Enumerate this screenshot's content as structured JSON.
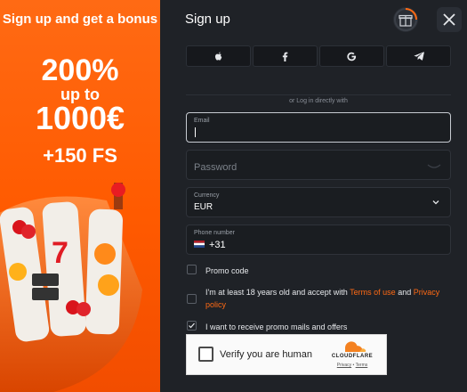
{
  "promo": {
    "headline": "Sign up and get a bonus",
    "percent": "200%",
    "up_to": "up to",
    "amount": "1000€",
    "free_spins": "+150 FS"
  },
  "form": {
    "title": "Sign up",
    "social_buttons": [
      "apple-icon",
      "facebook-icon",
      "google-icon",
      "telegram-icon"
    ],
    "divider_text": "or Log in directly with",
    "email": {
      "label": "Email",
      "value": ""
    },
    "password": {
      "placeholder": "Password"
    },
    "currency": {
      "label": "Currency",
      "value": "EUR"
    },
    "phone": {
      "label": "Phone number",
      "value": "+31"
    },
    "promo_code": {
      "label": "Promo code",
      "checked": false
    },
    "age": {
      "text": "I'm at least 18 years old and accept with",
      "terms_link": "Terms of use",
      "and": "and",
      "privacy_link": "Privacy policy",
      "checked": false
    },
    "promo_mails": {
      "label": "I want to receive promo mails and offers",
      "checked": true
    }
  },
  "captcha": {
    "label": "Verify you are human",
    "brand": "CLOUDFLARE",
    "privacy": "Privacy",
    "separator": "•",
    "terms": "Terms"
  },
  "colors": {
    "accent": "#ff6a14",
    "panel_bg": "#1f2227"
  }
}
